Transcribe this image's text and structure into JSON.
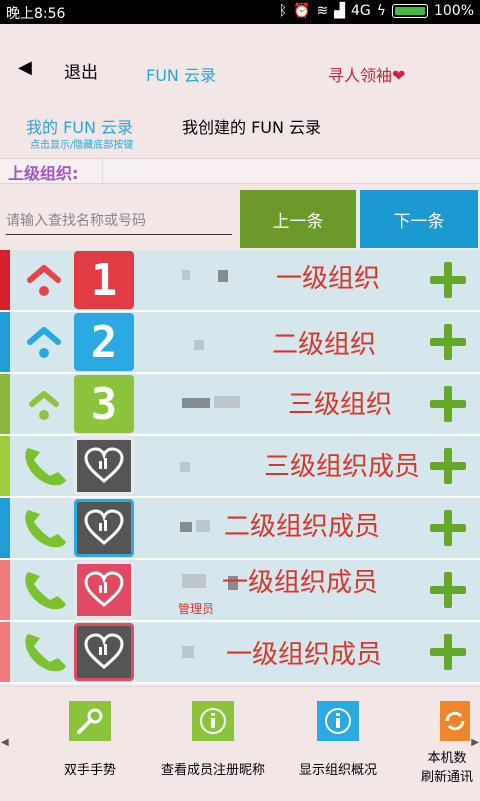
{
  "status": {
    "time": "晚上8:56",
    "network": "4G",
    "battery": "100%"
  },
  "header": {
    "back": "◀",
    "exit": "退出",
    "title": "FUN 云录",
    "seek": "寻人领袖❤"
  },
  "tabs": {
    "mine": "我的 FUN 云录",
    "mine_hint": "点击显示/隐藏底部按键",
    "created": "我创建的 FUN 云录"
  },
  "upper_org": {
    "label": "上级组织:"
  },
  "search": {
    "placeholder": "请输入查找名称或号码",
    "prev": "上一条",
    "next": "下一条"
  },
  "colors": {
    "level1": "#d81f2c",
    "level2": "#1f9fd6",
    "level3": "#8bb83a",
    "member_strip": "#9ccf3a",
    "plus": "#66a82a"
  },
  "rows": [
    {
      "label": "一级组织",
      "badge": "1",
      "icon": "up-arrow-red-icon"
    },
    {
      "label": "二级组织",
      "badge": "2",
      "icon": "up-arrow-blue-icon"
    },
    {
      "label": "三级组织",
      "badge": "3",
      "icon": "up-arrow-green-icon"
    },
    {
      "label": "三级组织成员",
      "icon": "phone-icon"
    },
    {
      "label": "二级组织成员",
      "icon": "phone-icon"
    },
    {
      "label": "一级组织成员",
      "icon": "phone-icon",
      "tag": "管理员"
    },
    {
      "label": "一级组织成员",
      "icon": "phone-icon"
    }
  ],
  "bottom": [
    {
      "label": "双手手势",
      "icon": "wrench-icon"
    },
    {
      "label": "查看成员注册昵称",
      "icon": "info-icon"
    },
    {
      "label": "显示组织概况",
      "icon": "info-icon"
    },
    {
      "label": "本机数",
      "label2": "刷新通讯",
      "icon": "refresh-icon"
    }
  ]
}
